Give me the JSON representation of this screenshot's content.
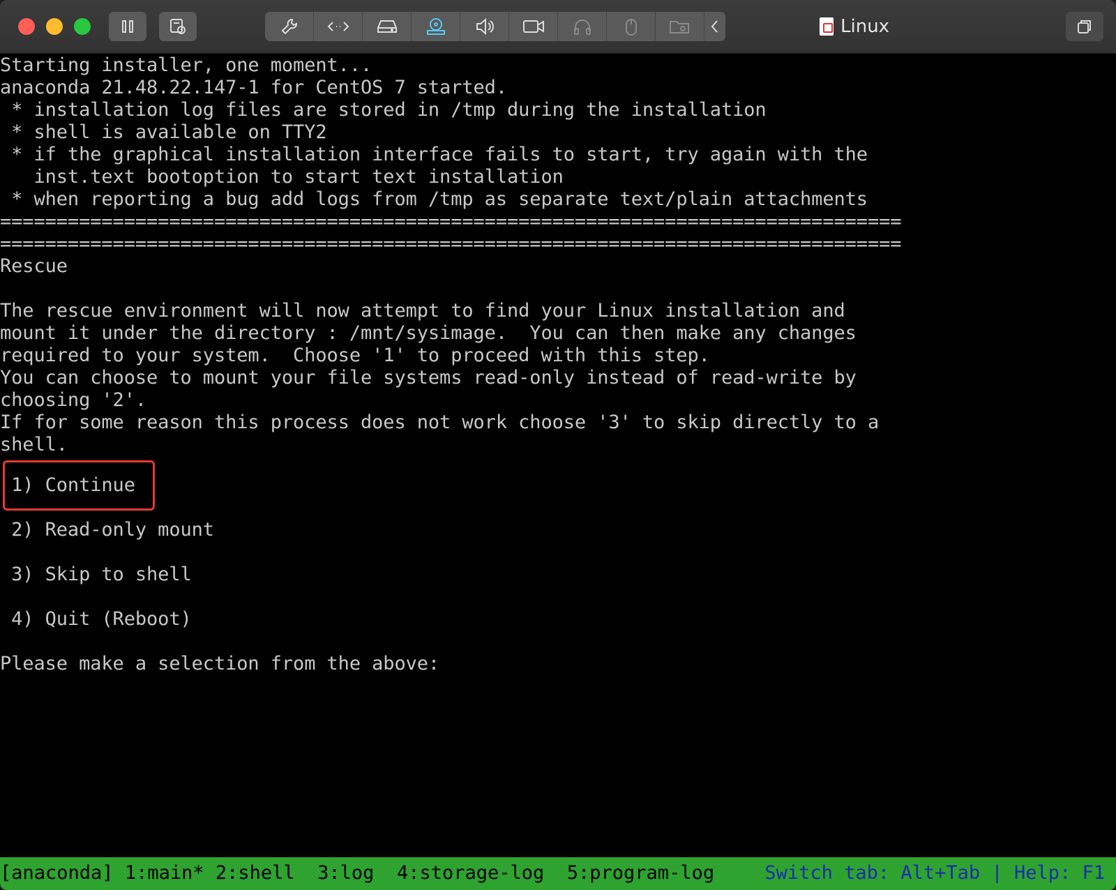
{
  "window": {
    "title": "Linux",
    "toolbar": {
      "pause_icon": "pause-icon",
      "snapshot_icon": "snapshot-icon",
      "icons": [
        "wrench-icon",
        "code-icon",
        "drive-icon",
        "cd-icon",
        "speaker-icon",
        "camera-icon",
        "headphones-icon",
        "mouse-icon",
        "folder-icon",
        "chevron-left-icon"
      ],
      "active_icon": "cd-icon",
      "active_color": "#59c7f0"
    }
  },
  "terminal": {
    "boot": [
      "Starting installer, one moment...",
      "anaconda 21.48.22.147-1 for CentOS 7 started.",
      " * installation log files are stored in /tmp during the installation",
      " * shell is available on TTY2",
      " * if the graphical installation interface fails to start, try again with the",
      "   inst.text bootoption to start text installation",
      " * when reporting a bug add logs from /tmp as separate text/plain attachments",
      "================================================================================",
      "================================================================================"
    ],
    "heading": "Rescue",
    "paragraph": [
      "The rescue environment will now attempt to find your Linux installation and",
      "mount it under the directory : /mnt/sysimage.  You can then make any changes",
      "required to your system.  Choose '1' to proceed with this step.",
      "You can choose to mount your file systems read-only instead of read-write by",
      "choosing '2'.",
      "If for some reason this process does not work choose '3' to skip directly to a",
      "shell."
    ],
    "options": [
      " 1) Continue",
      " 2) Read-only mount",
      " 3) Skip to shell",
      " 4) Quit (Reboot)"
    ],
    "highlighted_option": " 1) Continue",
    "prompt": "Please make a selection from the above:"
  },
  "statusbar": {
    "tabs": "[anaconda] 1:main* 2:shell  3:log  4:storage-log  5:program-log",
    "help": "Switch tab: Alt+Tab | Help: F1",
    "bg_color": "#2fa32f",
    "help_color": "#1a2ea8"
  }
}
